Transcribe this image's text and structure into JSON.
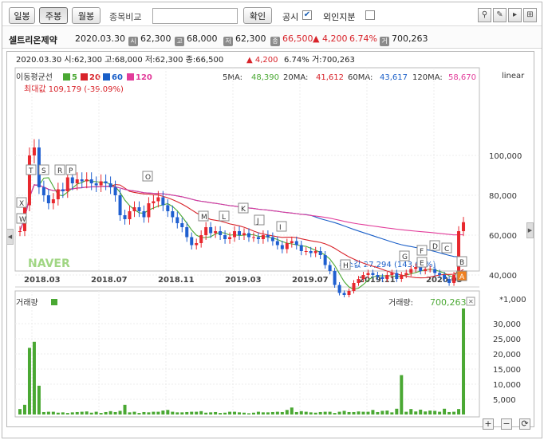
{
  "toolbar": {
    "day": "일봉",
    "week": "주봉",
    "month": "월봉",
    "search_label": "종목비교",
    "search_value": "",
    "confirm": "확인",
    "notice": "공시",
    "foreign": "외인지분"
  },
  "info": {
    "name": "셀트리온제약",
    "date": "2020.03.30",
    "open_badge": "시",
    "open": "62,300",
    "high_badge": "고",
    "high": "68,000",
    "low_badge": "저",
    "low": "62,300",
    "close_badge": "종",
    "close": "66,500",
    "change": "▲ 4,200",
    "pct": "6.74%",
    "vol_badge": "거",
    "volume": "700,263"
  },
  "header": {
    "line": "2020.03.30  시:62,300  고:68,000  저:62,300  종:66,500",
    "change": "▲    4,200",
    "rest": "6.74%  거:700,263"
  },
  "ma": {
    "title": "이동평균선",
    "l5": "5",
    "l20": "20",
    "l60": "60",
    "l120": "120",
    "ma5": "5MA:",
    "v5": "48,390",
    "ma20": "20MA:",
    "v20": "41,612",
    "ma60": "60MA:",
    "v60": "43,617",
    "ma120": "120MA:",
    "v120": "58,670",
    "scale": "linear",
    "c5": "#4aa833",
    "c20": "#d8232a",
    "c60": "#1a5fc8",
    "c120": "#e23c9a"
  },
  "max_label": "최대값 109,179 (-39.09%)",
  "min_label": "최소값 27,294 (143.64%)",
  "price_ticks": [
    "100,000",
    "80,000",
    "60,000",
    "40,000"
  ],
  "dates": [
    "2018.03",
    "2018.07",
    "2018.11",
    "2019.03",
    "2019.07",
    "2019.11",
    "2020.03"
  ],
  "markers": [
    "X",
    "W",
    "T",
    "S",
    "R",
    "P",
    "O",
    "M",
    "L",
    "K",
    "J",
    "I",
    "H",
    "G",
    "F",
    "E",
    "D",
    "C",
    "B",
    "A"
  ],
  "volume": {
    "title": "거래량",
    "label": "거래량:",
    "value": "700,263",
    "unit": "*1,000",
    "ticks": [
      "30,000",
      "25,000",
      "20,000",
      "15,000",
      "10,000",
      "5,000"
    ]
  },
  "logo": "NAVER",
  "chart_data": {
    "type": "candlestick",
    "note": "weekly prices (KRW)",
    "closes": [
      62000,
      75000,
      100000,
      104000,
      84000,
      80000,
      76000,
      78000,
      83000,
      82000,
      89000,
      86000,
      88000,
      87000,
      88000,
      86000,
      85000,
      87000,
      86000,
      84000,
      80000,
      70000,
      68000,
      72000,
      74000,
      72000,
      69000,
      76000,
      77000,
      79000,
      75000,
      72000,
      69000,
      66000,
      64000,
      59000,
      55000,
      56000,
      60000,
      64000,
      61000,
      62000,
      60000,
      58000,
      59000,
      62000,
      60000,
      61000,
      59000,
      59000,
      58000,
      60000,
      59000,
      57000,
      55000,
      53000,
      56000,
      57000,
      55000,
      52000,
      52000,
      51000,
      52000,
      50000,
      45000,
      42000,
      35000,
      31000,
      30000,
      32000,
      36000,
      38000,
      40000,
      41000,
      40000,
      39000,
      38000,
      40000,
      41000,
      38000,
      40000,
      41000,
      43000,
      44000,
      42000,
      43000,
      43000,
      41000,
      40000,
      38000,
      36000,
      40000,
      62000,
      66500
    ],
    "vol": [
      1800,
      3200,
      22000,
      24000,
      9500,
      800,
      900,
      900,
      600,
      700,
      500,
      700,
      800,
      900,
      1000,
      600,
      900,
      500,
      800,
      1100,
      800,
      1200,
      3200,
      700,
      900,
      500,
      800,
      700,
      900,
      900,
      1300,
      1500,
      900,
      700,
      700,
      800,
      900,
      900,
      1100,
      600,
      700,
      800,
      500,
      600,
      900,
      900,
      700,
      600,
      400,
      600,
      900,
      700,
      700,
      800,
      900,
      800,
      1500,
      2300,
      800,
      1100,
      900,
      700,
      600,
      800,
      900,
      900,
      500,
      900,
      1200,
      800,
      800,
      1000,
      900,
      900,
      1500,
      800,
      1200,
      1300,
      700,
      1900,
      13000,
      900,
      1800,
      1000,
      1600,
      1000,
      1300,
      1200,
      900,
      1900,
      800,
      900,
      1800,
      35000
    ]
  }
}
